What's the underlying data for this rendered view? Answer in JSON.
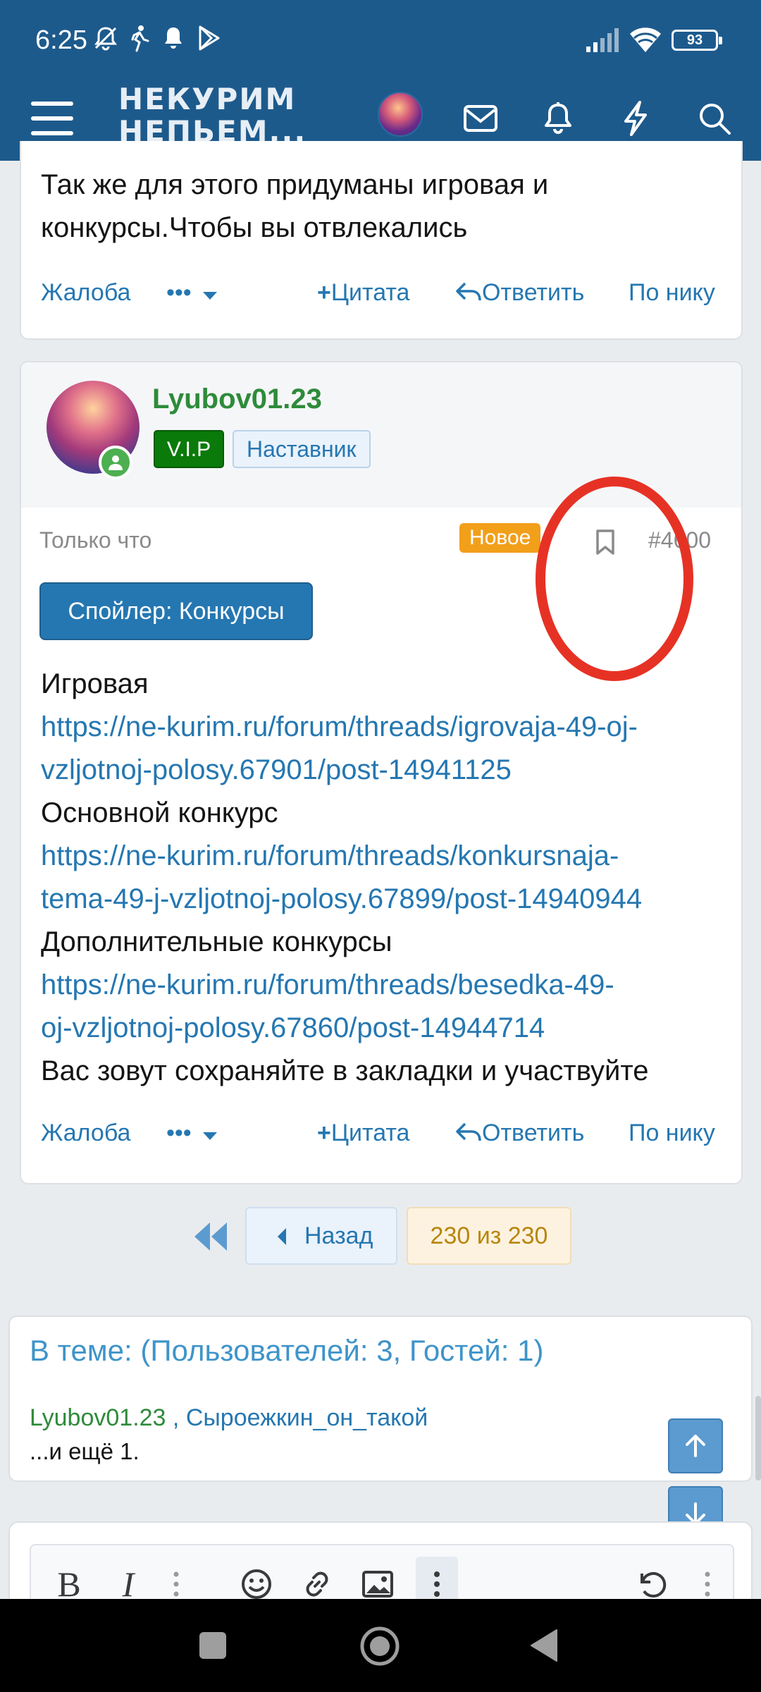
{
  "status_bar": {
    "time": "6:25",
    "battery": "93",
    "icons": [
      "mute-bell-icon",
      "walking-icon",
      "notification-bell-icon",
      "play-store-icon",
      "signal-icon",
      "wifi-icon",
      "battery-icon"
    ]
  },
  "header": {
    "logo_line1": "НЕКУРИМ",
    "logo_line2": "НЕПЬЕМ...",
    "icons": [
      "menu-icon",
      "avatar",
      "mail-icon",
      "bell-icon",
      "lightning-icon",
      "search-icon"
    ],
    "color": "#1d5a8c"
  },
  "post_prev": {
    "text_line1": "Так же для этого придуманы игровая и",
    "text_line2": "конкурсы.Чтобы вы отвлекались"
  },
  "actions": {
    "report": "Жалоба",
    "more": "•••",
    "quote": "Цитата",
    "reply": "Ответить",
    "by_nick": "По нику"
  },
  "post": {
    "username": "Lyubov01.23",
    "badge_vip": "V.I.P",
    "badge_role": "Наставник",
    "time": "Только что",
    "badge_new": "Новое",
    "number": "#4600",
    "spoiler_label": "Спойлер: Конкурсы",
    "lines": [
      {
        "text": "Игровая",
        "type": "text"
      },
      {
        "text": "https://ne-kurim.ru/forum/threads/igrovaja-49-oj-",
        "type": "link"
      },
      {
        "text": "vzljotnoj-polosy.67901/post-14941125",
        "type": "link"
      },
      {
        "text": "Основной конкурс",
        "type": "text"
      },
      {
        "text": "https://ne-kurim.ru/forum/threads/konkursnaja-",
        "type": "link"
      },
      {
        "text": "tema-49-j-vzljotnoj-polosy.67899/post-14940944",
        "type": "link"
      },
      {
        "text": "Дополнительные конкурсы",
        "type": "text"
      },
      {
        "text": "https://ne-kurim.ru/forum/threads/besedka-49-",
        "type": "link"
      },
      {
        "text": "oj-vzljotnoj-polosy.67860/post-14944714",
        "type": "link"
      },
      {
        "text": "Вас зовут сохраняйте в закладки и участвуйте",
        "type": "text"
      }
    ]
  },
  "pagination": {
    "back": "Назад",
    "current": "230 из 230"
  },
  "online": {
    "title": "В теме: (Пользователей: 3, Гостей: 1)",
    "user1": "Lyubov01.23",
    "separator": " , ",
    "user2": "Сыроежкин_он_такой",
    "more": "...и ещё 1."
  },
  "editor": {
    "tools": [
      "bold-icon",
      "italic-icon",
      "more-vert-icon",
      "emoji-icon",
      "link-icon",
      "image-icon",
      "more-vert-icon",
      "undo-icon",
      "more-vert-icon"
    ],
    "bold_label": "B",
    "italic_label": "I"
  },
  "colors": {
    "header": "#1d5a8c",
    "link": "#2577b1",
    "username": "#2e8b3a",
    "vip": "#0a7a0a",
    "new_badge": "#f29f1a",
    "annotation": "#e63225"
  }
}
